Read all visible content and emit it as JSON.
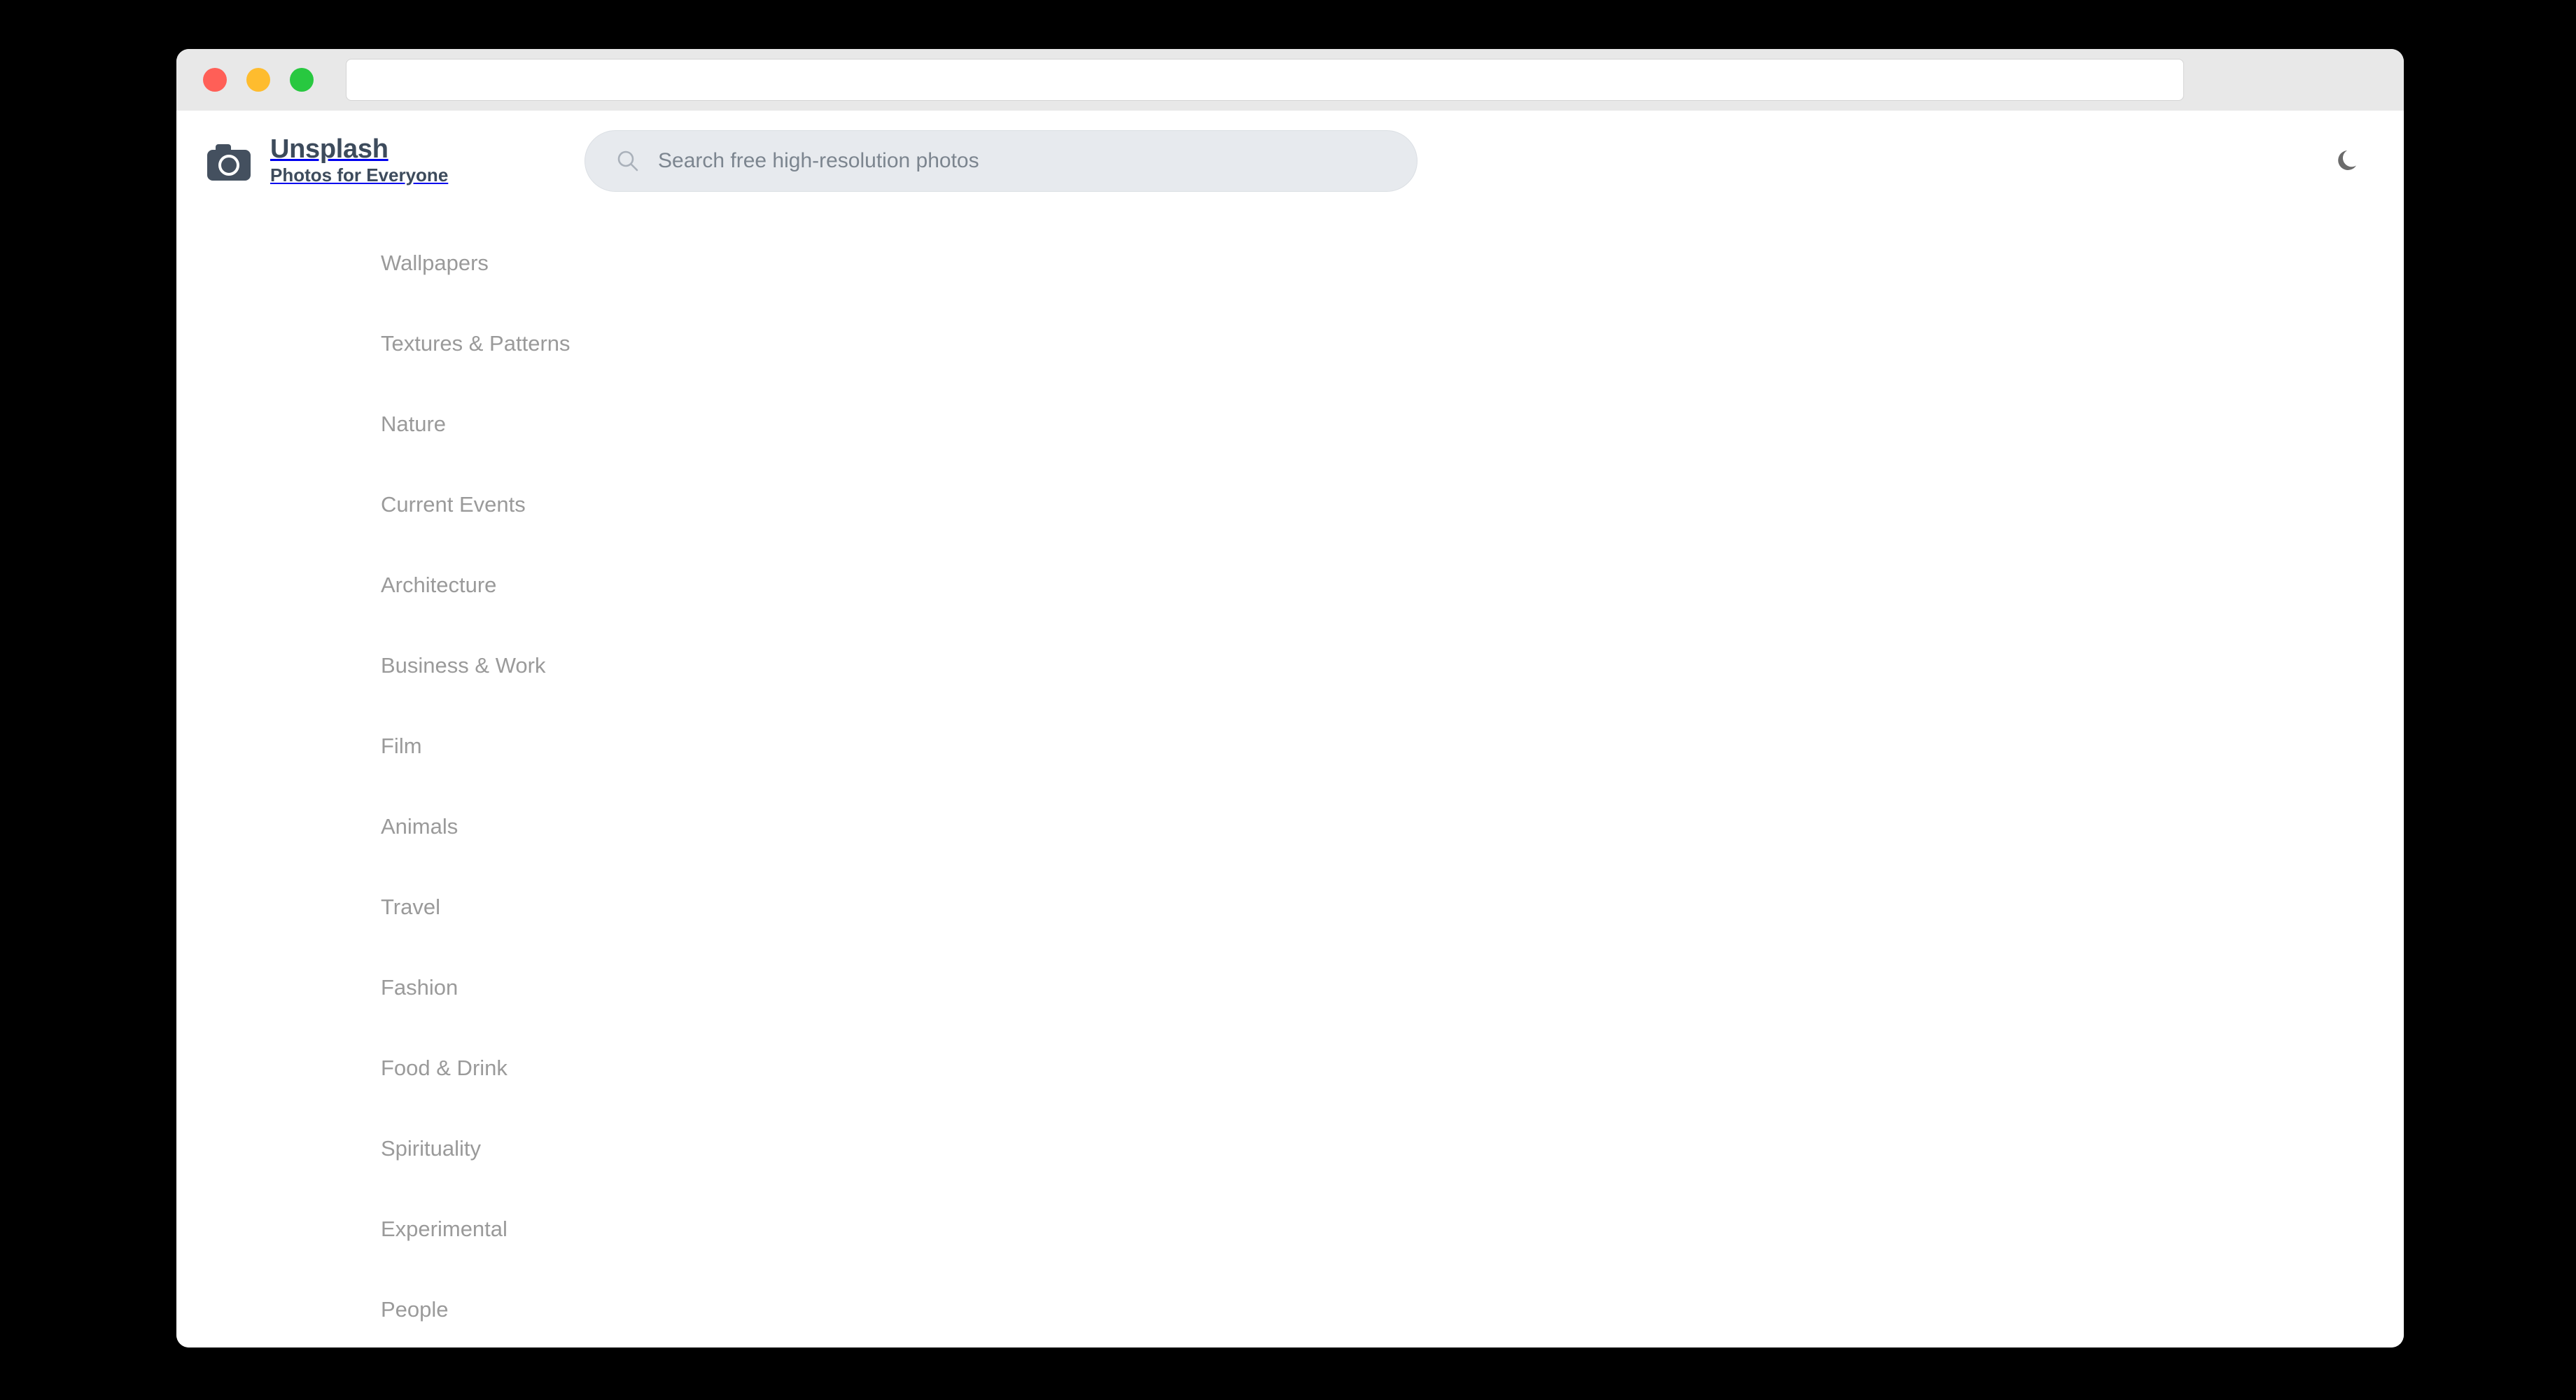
{
  "window": {
    "traffic_lights": [
      {
        "name": "close",
        "color": "#ff5f57"
      },
      {
        "name": "minimize",
        "color": "#febc2e"
      },
      {
        "name": "maximize",
        "color": "#28c840"
      }
    ],
    "url_value": "",
    "url_placeholder": ""
  },
  "brand": {
    "title": "Unsplash",
    "tagline": "Photos for Everyone",
    "logo_icon": "camera-icon",
    "logo_color": "#44505f"
  },
  "search": {
    "value": "",
    "placeholder": "Search free high-resolution photos",
    "icon": "search-icon"
  },
  "header": {
    "dark_mode_icon": "moon-icon",
    "dark_mode_icon_color": "#6b6b6b"
  },
  "sidebar": {
    "items": [
      {
        "label": "Wallpapers"
      },
      {
        "label": "Textures & Patterns"
      },
      {
        "label": "Nature"
      },
      {
        "label": "Current Events"
      },
      {
        "label": "Architecture"
      },
      {
        "label": "Business & Work"
      },
      {
        "label": "Film"
      },
      {
        "label": "Animals"
      },
      {
        "label": "Travel"
      },
      {
        "label": "Fashion"
      },
      {
        "label": "Food & Drink"
      },
      {
        "label": "Spirituality"
      },
      {
        "label": "Experimental"
      },
      {
        "label": "People"
      }
    ]
  },
  "colors": {
    "titlebar_bg": "#e8e8e8",
    "page_bg": "#ffffff",
    "nav_text": "#9a9a9a",
    "search_bg": "#e7eaee"
  }
}
